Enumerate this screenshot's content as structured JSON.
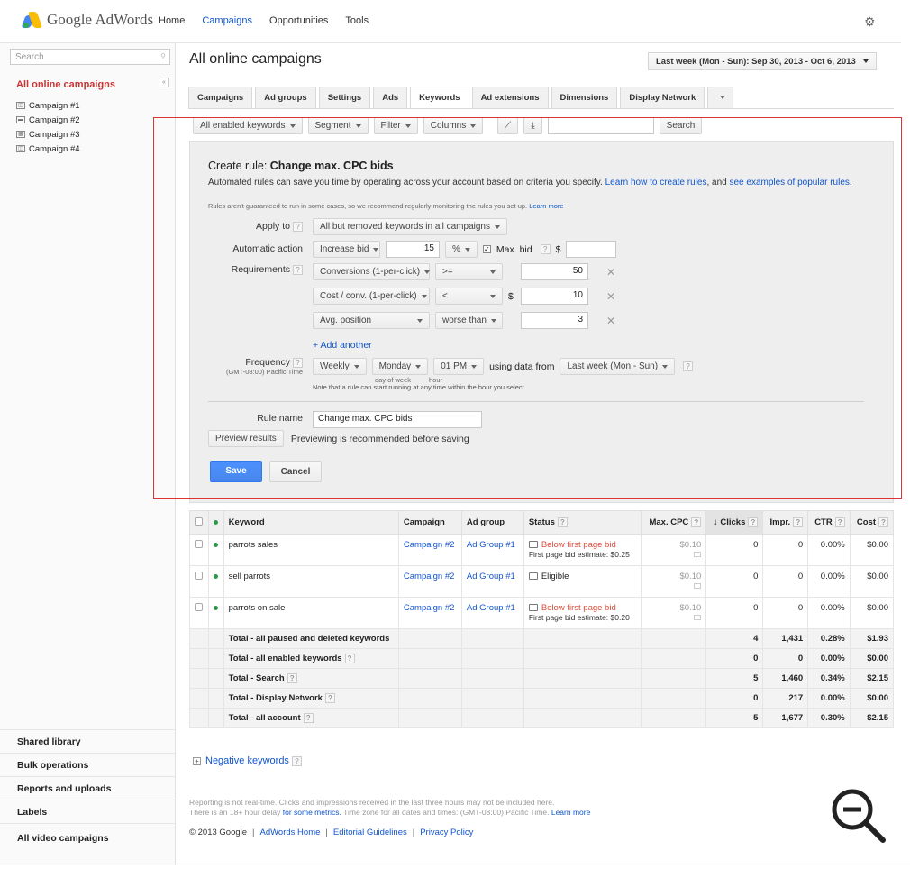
{
  "app": {
    "logo_text": "Google AdWords"
  },
  "topnav": [
    "Home",
    "Campaigns",
    "Opportunities",
    "Tools"
  ],
  "sidebar": {
    "search_placeholder": "Search",
    "all_label": "All online campaigns",
    "campaigns": [
      "Campaign #1",
      "Campaign #2",
      "Campaign #3",
      "Campaign #4"
    ],
    "bottom_items": [
      "Shared library",
      "Bulk operations",
      "Reports and uploads",
      "Labels",
      "All video campaigns"
    ]
  },
  "main": {
    "title": "All online campaigns",
    "date_range": "Last week (Mon - Sun): Sep 30, 2013 - Oct 6, 2013",
    "tabs": [
      "Campaigns",
      "Ad groups",
      "Settings",
      "Ads",
      "Keywords",
      "Ad extensions",
      "Dimensions",
      "Display Network"
    ],
    "active_tab": "Keywords",
    "filterbar": {
      "keywords_filter": "All enabled keywords",
      "segment": "Segment",
      "filter": "Filter",
      "columns": "Columns",
      "search_button": "Search"
    }
  },
  "rule": {
    "title_prefix": "Create rule: ",
    "title_name": "Change max. CPC bids",
    "desc": "Automated rules can save you time by operating across your account based on criteria you specify.",
    "desc_link1": "Learn how to create rules",
    "desc_and": ", and",
    "desc_link2": "see examples of popular rules",
    "note": "Rules aren't guaranteed to run in some cases, so we recommend regularly monitoring the rules you set up.",
    "note_link": "Learn more",
    "apply_to_label": "Apply to",
    "apply_to_value": "All but removed keywords in all campaigns",
    "action_label": "Automatic action",
    "action_value": "Increase bid",
    "action_amount": "15",
    "action_unit": "%",
    "maxbid_label": "Max. bid",
    "maxbid_currency": "$",
    "requirements_label": "Requirements",
    "requirements": [
      {
        "metric": "Conversions (1-per-click)",
        "op": ">=",
        "currency": "",
        "value": "50"
      },
      {
        "metric": "Cost / conv. (1-per-click)",
        "op": "<",
        "currency": "$",
        "value": "10"
      },
      {
        "metric": "Avg. position",
        "op": "worse than",
        "currency": "",
        "value": "3"
      }
    ],
    "add_another": "+ Add another",
    "frequency_label": "Frequency",
    "timezone": "(GMT-08:00) Pacific Time",
    "frequency": "Weekly",
    "day": "Monday",
    "hour": "01 PM",
    "day_caption": "day of week",
    "hour_caption": "hour",
    "using_data_from": "using data from",
    "data_range": "Last week (Mon - Sun)",
    "freq_note": "Note that a rule can start running at any time within the hour you select.",
    "rule_name_label": "Rule name",
    "rule_name_value": "Change max. CPC bids",
    "preview_button": "Preview results",
    "preview_note": "Previewing is recommended before saving",
    "save": "Save",
    "cancel": "Cancel"
  },
  "table": {
    "headers": [
      "Keyword",
      "Campaign",
      "Ad group",
      "Status",
      "Max. CPC",
      "Clicks",
      "Impr.",
      "CTR",
      "Cost"
    ],
    "rows": [
      {
        "keyword": "parrots sales",
        "campaign": "Campaign #2",
        "adgroup": "Ad Group #1",
        "status": "Below first page bid",
        "status_sub": "First page bid estimate: $0.25",
        "maxcpc": "$0.10",
        "clicks": "0",
        "impr": "0",
        "ctr": "0.00%",
        "cost": "$0.00"
      },
      {
        "keyword": "sell parrots",
        "campaign": "Campaign #2",
        "adgroup": "Ad Group #1",
        "status": "Eligible",
        "status_sub": "",
        "maxcpc": "$0.10",
        "clicks": "0",
        "impr": "0",
        "ctr": "0.00%",
        "cost": "$0.00"
      },
      {
        "keyword": "parrots on sale",
        "campaign": "Campaign #2",
        "adgroup": "Ad Group #1",
        "status": "Below first page bid",
        "status_sub": "First page bid estimate: $0.20",
        "maxcpc": "$0.10",
        "clicks": "0",
        "impr": "0",
        "ctr": "0.00%",
        "cost": "$0.00"
      }
    ],
    "totals": [
      {
        "label": "Total - all paused and deleted keywords",
        "clicks": "4",
        "impr": "1,431",
        "ctr": "0.28%",
        "cost": "$1.93"
      },
      {
        "label": "Total - all enabled keywords",
        "clicks": "0",
        "impr": "0",
        "ctr": "0.00%",
        "cost": "$0.00"
      },
      {
        "label": "Total - Search",
        "clicks": "5",
        "impr": "1,460",
        "ctr": "0.34%",
        "cost": "$2.15"
      },
      {
        "label": "Total - Display Network",
        "clicks": "0",
        "impr": "217",
        "ctr": "0.00%",
        "cost": "$0.00"
      },
      {
        "label": "Total - all account",
        "clicks": "5",
        "impr": "1,677",
        "ctr": "0.30%",
        "cost": "$2.15"
      }
    ]
  },
  "negative_keywords": "Negative keywords",
  "report_note": {
    "line1": "Reporting is not real-time. Clicks and impressions received in the last three hours may not be included here.",
    "line2a": "There is an 18+ hour delay",
    "line2_link": "for some metrics.",
    "line2b": "Time zone for all dates and times: (GMT-08:00) Pacific Time.",
    "line2_link2": "Learn more"
  },
  "footer": {
    "copyright": "© 2013 Google",
    "links": [
      "AdWords Home",
      "Editorial Guidelines",
      "Privacy Policy"
    ]
  },
  "colors": {
    "link": "#1155cc",
    "active_red": "#cc3333",
    "save_blue": "#4d90fe",
    "status_red": "#dd4b39",
    "highlight_box": "#dd3333"
  }
}
